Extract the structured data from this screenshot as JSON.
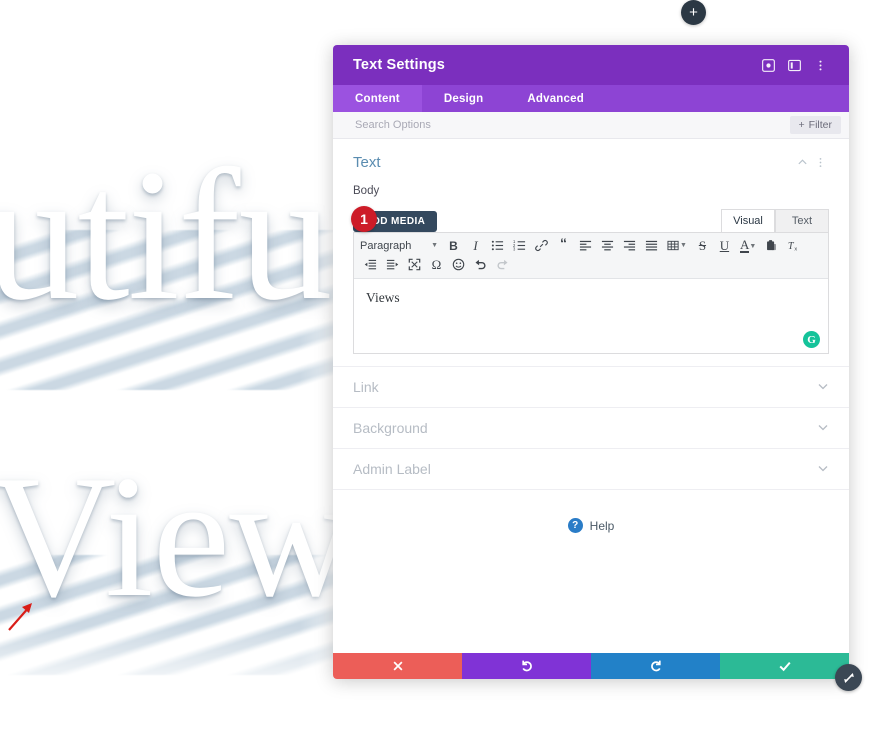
{
  "page_background": {
    "word_top": "autifu",
    "word_bottom": "View"
  },
  "annotation": {
    "arrow_name": "red-pointer-arrow",
    "step_number": "1"
  },
  "add_section": {
    "label": "+"
  },
  "modal": {
    "title": "Text Settings",
    "header_icons": [
      {
        "name": "focus-target-icon",
        "glyph": "◎"
      },
      {
        "name": "panel-layout-icon",
        "glyph": "▧"
      },
      {
        "name": "more-options-icon",
        "glyph": "⋮"
      }
    ],
    "tabs": [
      {
        "label": "Content",
        "active": true
      },
      {
        "label": "Design",
        "active": false
      },
      {
        "label": "Advanced",
        "active": false
      }
    ],
    "search": {
      "placeholder": "Search Options",
      "value": ""
    },
    "filter_button": {
      "label": "Filter",
      "plus": "+"
    },
    "colors": {
      "header": "#7b2fbe",
      "tabbar": "#8d44d4",
      "tab_active": "#9b52e0",
      "cancel": "#ec5e58",
      "undo": "#8033d6",
      "redo": "#2281c8",
      "save": "#2cba96",
      "badge": "#cd1c28",
      "grammarly": "#15c39a"
    },
    "sections": {
      "text": {
        "title": "Text",
        "collapse_icon": "⌃",
        "menu_icon": "⋮",
        "body_label": "Body",
        "add_media_label": "ADD MEDIA",
        "editor_mode_tabs": [
          {
            "label": "Visual",
            "active": true
          },
          {
            "label": "Text",
            "active": false
          }
        ],
        "toolbar_row1": [
          {
            "name": "paragraph-format-select",
            "label": "Paragraph",
            "type": "select"
          },
          {
            "name": "bold-icon",
            "label": "B",
            "type": "bold"
          },
          {
            "name": "italic-icon",
            "label": "I",
            "type": "italic"
          },
          {
            "name": "bulleted-list-icon",
            "type": "ul"
          },
          {
            "name": "numbered-list-icon",
            "type": "ol"
          },
          {
            "name": "link-icon",
            "type": "link"
          },
          {
            "name": "blockquote-icon",
            "label": "“",
            "type": "quote"
          },
          {
            "name": "align-left-icon",
            "type": "align-left"
          },
          {
            "name": "align-center-icon",
            "type": "align-center"
          },
          {
            "name": "align-right-icon",
            "type": "align-right"
          },
          {
            "name": "align-justify-icon",
            "type": "align-justify"
          },
          {
            "name": "table-icon",
            "type": "table"
          },
          {
            "name": "strikethrough-icon",
            "label": "S",
            "type": "strike"
          },
          {
            "name": "underline-icon",
            "label": "U",
            "type": "underline"
          },
          {
            "name": "text-color-icon",
            "label": "A",
            "type": "textcolor"
          },
          {
            "name": "paste-as-text-icon",
            "type": "paste"
          },
          {
            "name": "clear-formatting-icon",
            "label": "T",
            "type": "clearfmt"
          }
        ],
        "toolbar_row2": [
          {
            "name": "outdent-icon",
            "type": "outdent"
          },
          {
            "name": "indent-icon",
            "type": "indent"
          },
          {
            "name": "fullscreen-icon",
            "type": "fullscreen"
          },
          {
            "name": "special-character-icon",
            "label": "Ω",
            "type": "omega"
          },
          {
            "name": "emoji-icon",
            "label": "☺",
            "type": "emoji"
          },
          {
            "name": "undo-icon",
            "type": "undo"
          },
          {
            "name": "redo-icon",
            "type": "redo",
            "disabled": true
          }
        ],
        "editor_value": "Views",
        "grammarly_label": "G"
      },
      "collapsed": [
        {
          "name": "link",
          "title": "Link"
        },
        {
          "name": "background",
          "title": "Background"
        },
        {
          "name": "admin-label",
          "title": "Admin Label"
        }
      ]
    },
    "help": {
      "label": "Help",
      "icon_glyph": "?"
    },
    "footer_buttons": [
      {
        "name": "cancel-button",
        "glyph": "✖",
        "color": "#ec5e58"
      },
      {
        "name": "undo-button",
        "glyph": "↺",
        "color": "#8033d6"
      },
      {
        "name": "redo-button",
        "glyph": "↻",
        "color": "#2281c8"
      },
      {
        "name": "save-button",
        "glyph": "✔",
        "color": "#2cba96"
      }
    ],
    "resize_handle": {
      "name": "resize-handle"
    }
  }
}
